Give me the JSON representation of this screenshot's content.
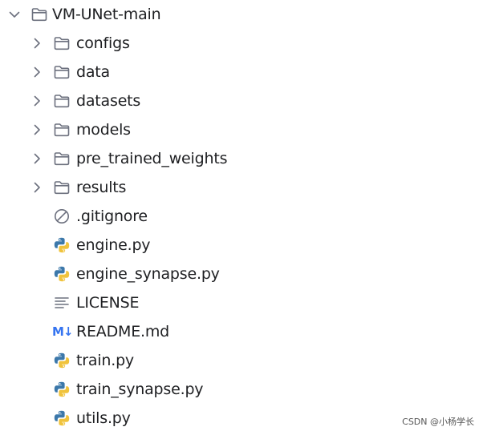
{
  "project_tree": {
    "root": {
      "label": "VM-UNet-main",
      "expanded": true,
      "icon": "folder-icon"
    },
    "items": [
      {
        "label": "configs",
        "type": "folder",
        "icon": "folder-icon",
        "expanded": false
      },
      {
        "label": "data",
        "type": "folder",
        "icon": "folder-icon",
        "expanded": false
      },
      {
        "label": "datasets",
        "type": "folder",
        "icon": "folder-icon",
        "expanded": false
      },
      {
        "label": "models",
        "type": "folder",
        "icon": "folder-icon",
        "expanded": false
      },
      {
        "label": "pre_trained_weights",
        "type": "folder",
        "icon": "folder-icon",
        "expanded": false
      },
      {
        "label": "results",
        "type": "folder",
        "icon": "folder-icon",
        "expanded": false
      },
      {
        "label": ".gitignore",
        "type": "file",
        "icon": "ignore-file-icon"
      },
      {
        "label": "engine.py",
        "type": "file",
        "icon": "python-file-icon"
      },
      {
        "label": "engine_synapse.py",
        "type": "file",
        "icon": "python-file-icon"
      },
      {
        "label": "LICENSE",
        "type": "file",
        "icon": "text-file-icon"
      },
      {
        "label": "README.md",
        "type": "file",
        "icon": "markdown-file-icon",
        "icon_text": "M↓"
      },
      {
        "label": "train.py",
        "type": "file",
        "icon": "python-file-icon"
      },
      {
        "label": "train_synapse.py",
        "type": "file",
        "icon": "python-file-icon"
      },
      {
        "label": "utils.py",
        "type": "file",
        "icon": "python-file-icon"
      }
    ]
  },
  "watermark": "CSDN @小杨学长",
  "colors": {
    "text": "#1e1f22",
    "icon_gray": "#6c707e",
    "markdown_blue": "#3574f0",
    "python_blue": "#3c78aa",
    "python_yellow": "#f0c33c"
  }
}
